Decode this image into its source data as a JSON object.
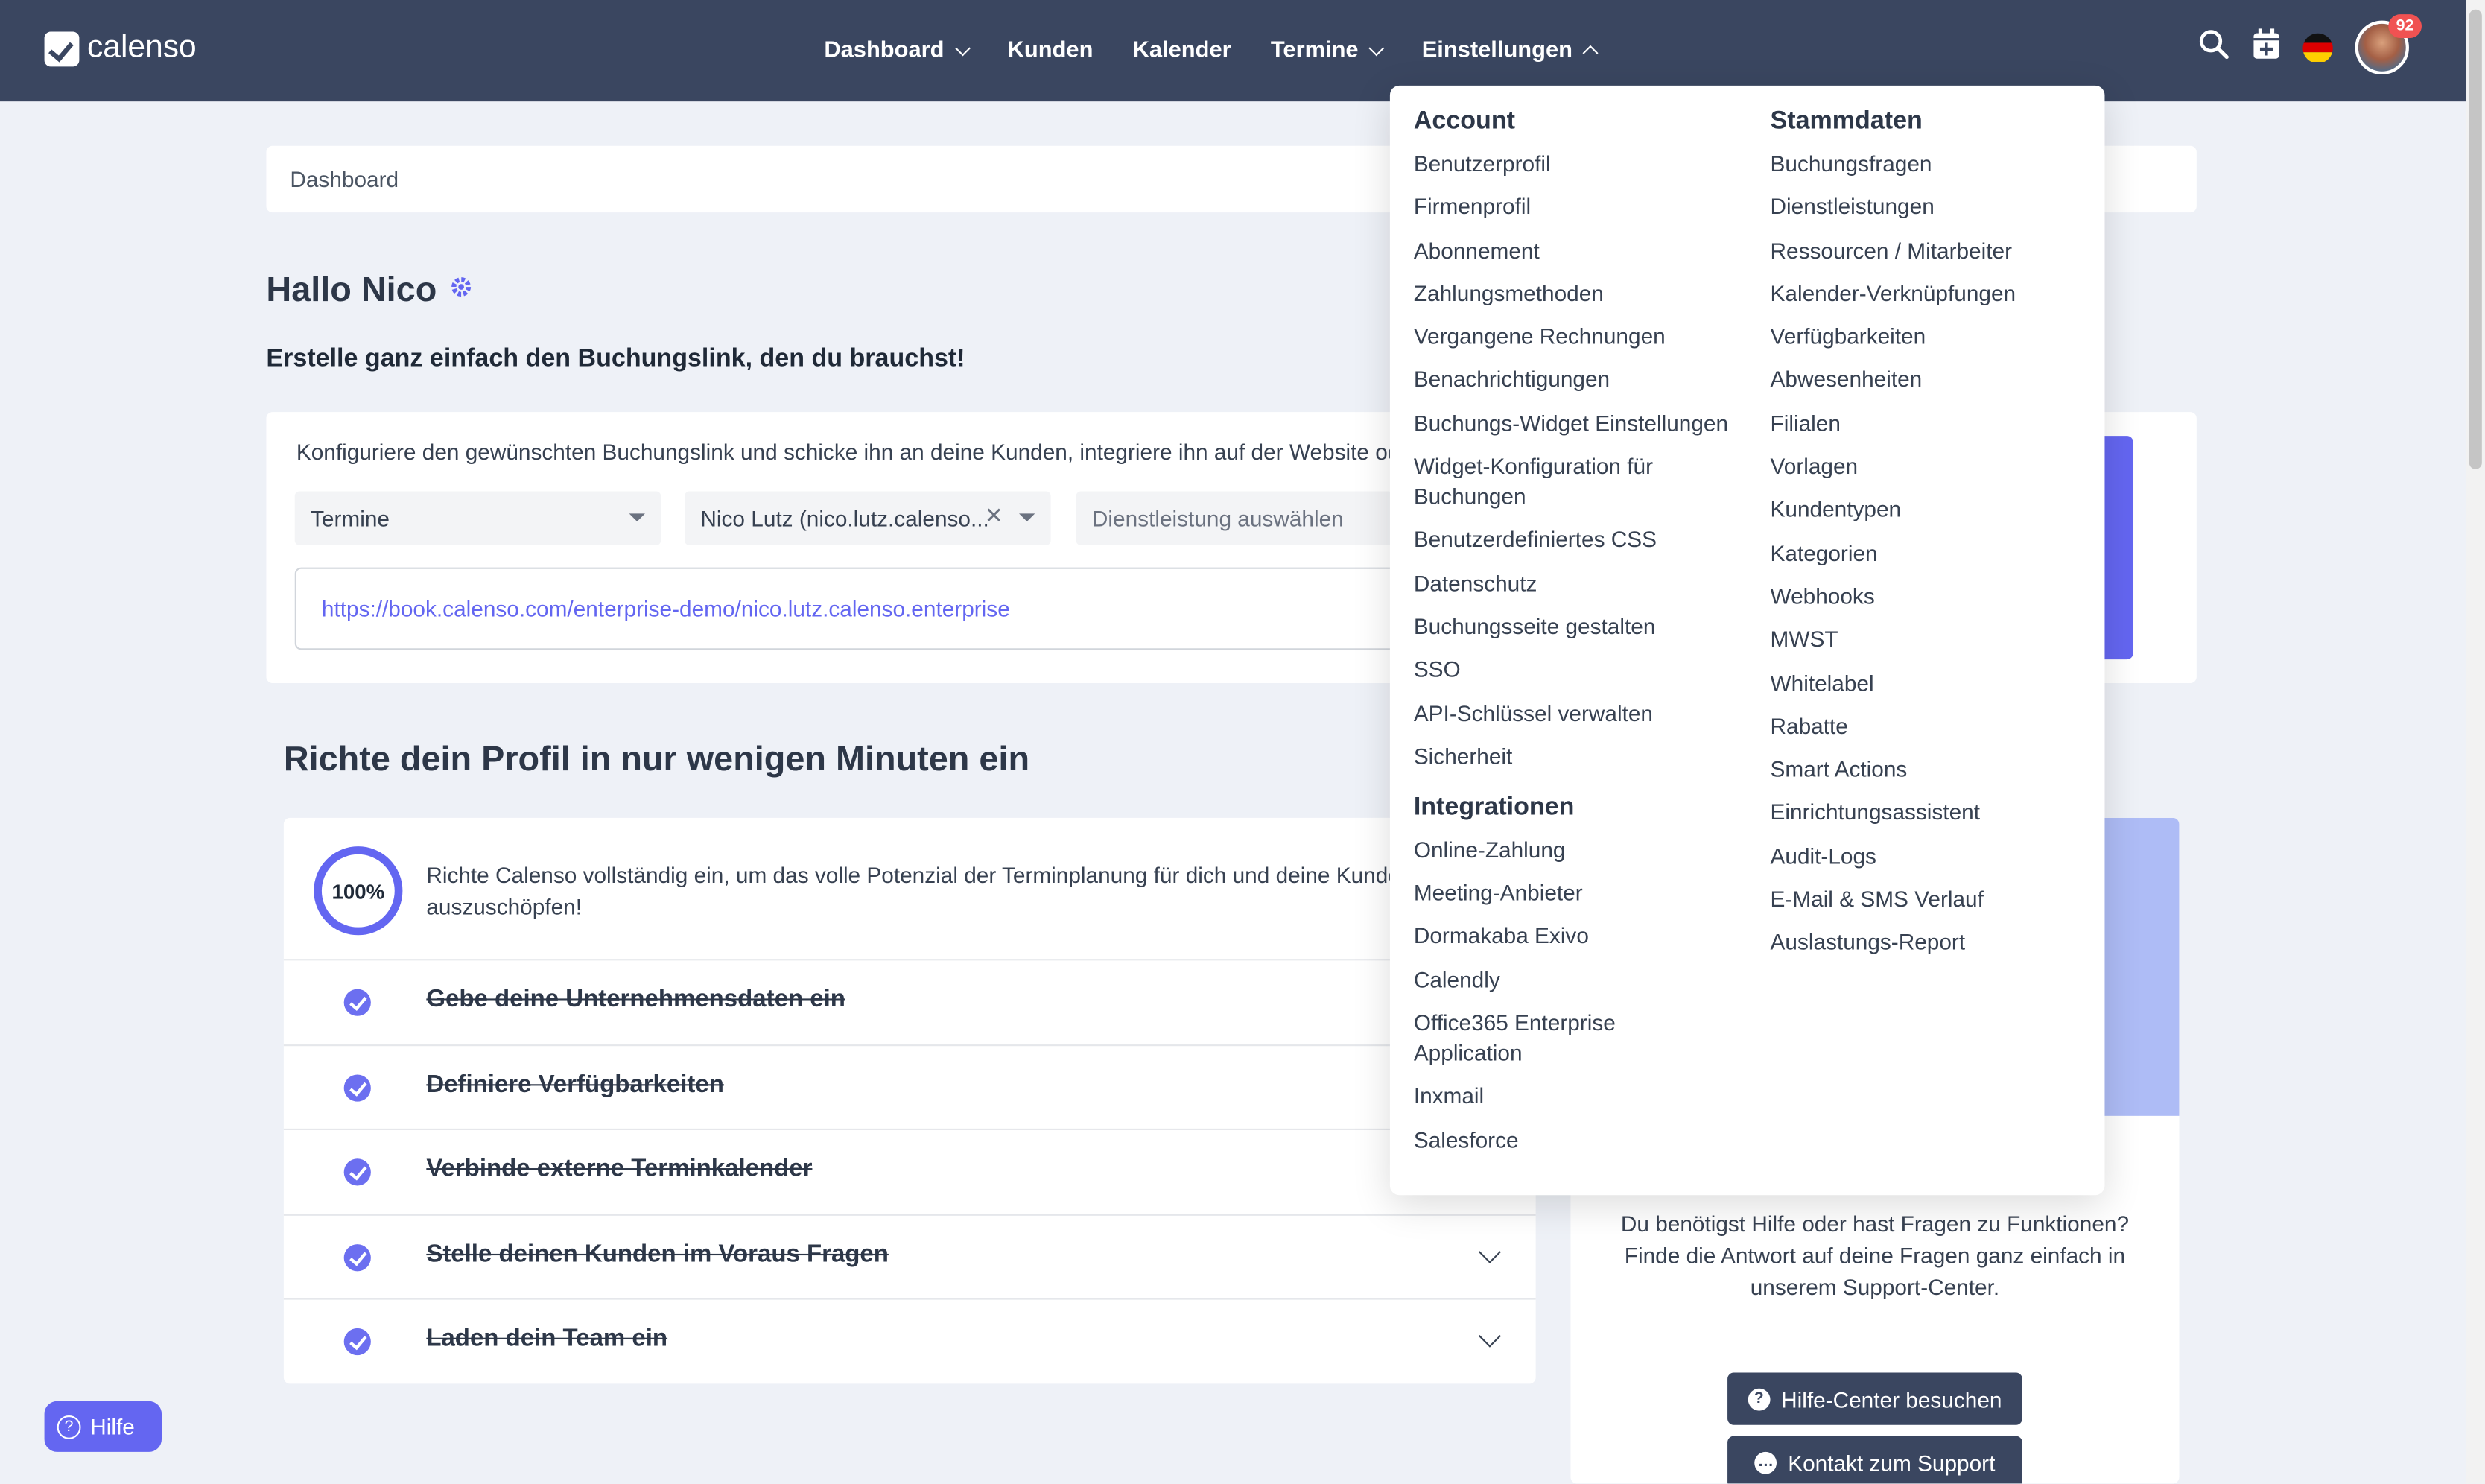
{
  "brand": {
    "name": "calenso"
  },
  "nav": {
    "items": [
      {
        "label": "Dashboard"
      },
      {
        "label": "Kunden"
      },
      {
        "label": "Kalender"
      },
      {
        "label": "Termine"
      },
      {
        "label": "Einstellungen"
      }
    ]
  },
  "topbar": {
    "notification_count": "92",
    "icons": [
      "search-icon",
      "calendar-add-icon",
      "german-flag-icon",
      "avatar"
    ]
  },
  "breadcrumb": "Dashboard",
  "greeting": "Hallo Nico",
  "subtitle": "Erstelle ganz einfach den Buchungslink, den du brauchst!",
  "booking": {
    "description": "Konfiguriere den gewünschten Buchungslink und schicke ihn an deine Kunden, integriere ihn auf der Website ode",
    "select_type": "Termine",
    "select_worker": "Nico Lutz (nico.lutz.calenso...",
    "select_service_placeholder": "Dienstleistung auswählen",
    "url": "https://book.calenso.com/enterprise-demo/nico.lutz.calenso.enterprise"
  },
  "setup": {
    "title": "Richte dein Profil in nur wenigen Minuten ein",
    "progress": "100%",
    "intro": "Richte Calenso vollständig ein, um das volle Potenzial der Terminplanung für dich und deine Kunden auszuschöpfen!",
    "steps": [
      {
        "label": "Gebe deine Unternehmensdaten ein"
      },
      {
        "label": "Definiere Verfügbarkeiten"
      },
      {
        "label": "Verbinde externe Terminkalender"
      },
      {
        "label": "Stelle deinen Kunden im Voraus Fragen"
      },
      {
        "label": "Laden dein Team ein"
      }
    ]
  },
  "support": {
    "text": "Du benötigst Hilfe oder hast Fragen zu Funktionen? Finde die Antwort auf deine Fragen ganz einfach in unserem Support-Center.",
    "help_center_label": "Hilfe-Center besuchen",
    "contact_label": "Kontakt zum Support"
  },
  "help_button": "Hilfe",
  "settings_menu": {
    "account": {
      "title": "Account",
      "items": [
        "Benutzerprofil",
        "Firmenprofil",
        "Abonnement",
        "Zahlungsmethoden",
        "Vergangene Rechnungen",
        "Benachrichtigungen",
        "Buchungs-Widget Einstellungen",
        "Widget-Konfiguration für Buchungen",
        "Benutzerdefiniertes CSS",
        "Datenschutz",
        "Buchungsseite gestalten",
        "SSO",
        "API-Schlüssel verwalten",
        "Sicherheit"
      ]
    },
    "integrations": {
      "title": "Integrationen",
      "items": [
        "Online-Zahlung",
        "Meeting-Anbieter",
        "Dormakaba Exivo",
        "Calendly",
        "Office365 Enterprise Application",
        "Inxmail",
        "Salesforce"
      ]
    },
    "master_data": {
      "title": "Stammdaten",
      "items": [
        "Buchungsfragen",
        "Dienstleistungen",
        "Ressourcen / Mitarbeiter",
        "Kalender-Verknüpfungen",
        "Verfügbarkeiten",
        "Abwesenheiten",
        "Filialen",
        "Vorlagen",
        "Kundentypen",
        "Kategorien",
        "Webhooks",
        "MWST",
        "Whitelabel",
        "Rabatte",
        "Smart Actions",
        "Einrichtungsassistent",
        "Audit-Logs",
        "E-Mail & SMS Verlauf",
        "Auslastungs-Report"
      ]
    }
  },
  "colors": {
    "topbar": "#3a4660",
    "accent": "#6366f1",
    "background": "#eef1f7"
  }
}
